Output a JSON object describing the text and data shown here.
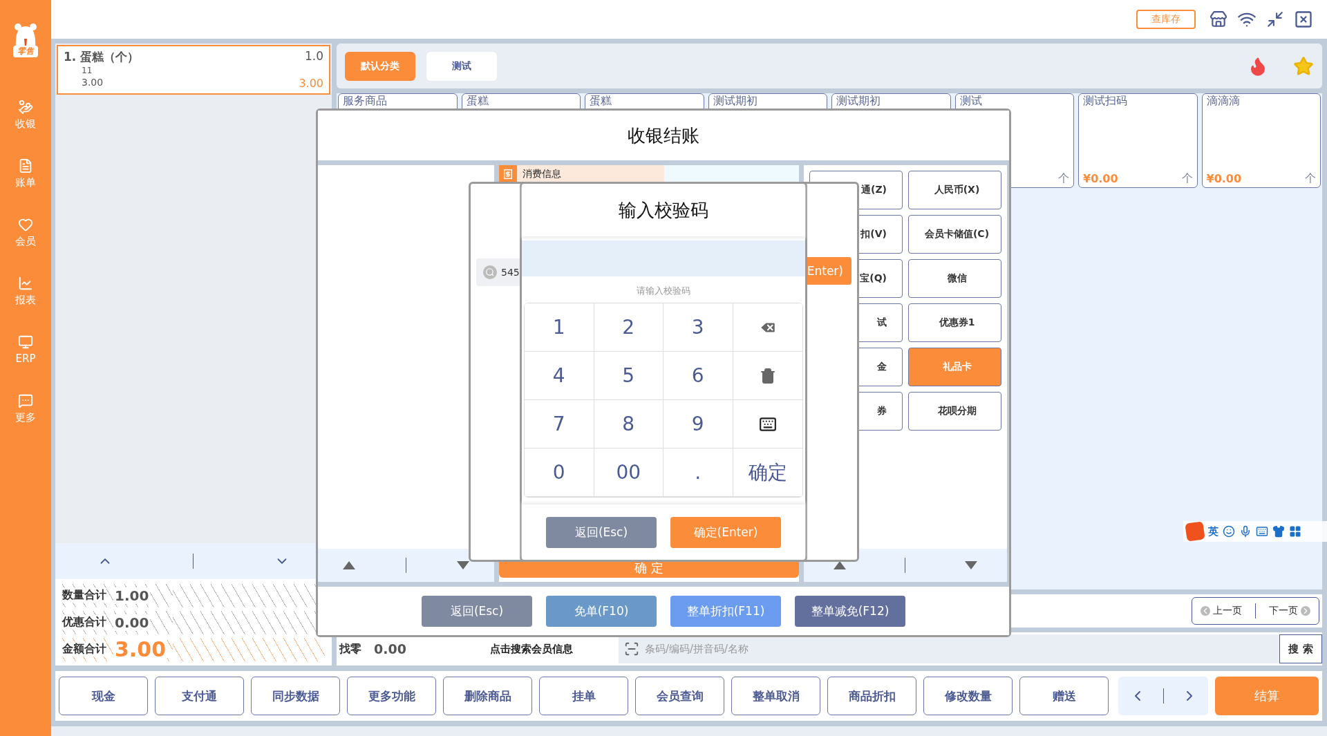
{
  "sidebar": {
    "logo": "零售",
    "items": [
      {
        "label": "收银",
        "kind": "cashier"
      },
      {
        "label": "账单",
        "kind": "bill"
      },
      {
        "label": "会员",
        "kind": "member"
      },
      {
        "label": "报表",
        "kind": "report"
      },
      {
        "label": "ERP",
        "kind": "erp"
      },
      {
        "label": "更多",
        "kind": "more"
      }
    ]
  },
  "topbar": {
    "stock_button": "查库存"
  },
  "cart": {
    "items": [
      {
        "index": "1.",
        "name": "蛋糕（个）",
        "qty": "1.0",
        "code": "11",
        "price": "3.00",
        "amount": "3.00",
        "selected": true
      }
    ]
  },
  "totals": [
    {
      "label": "数量合计",
      "value": "1.00",
      "kind": "plain"
    },
    {
      "label": "优惠合计",
      "value": "0.00",
      "kind": "plain"
    },
    {
      "label": "金额合计",
      "value": "3.00",
      "kind": "emphasis"
    }
  ],
  "categories": [
    {
      "label": "默认分类",
      "selected": true
    },
    {
      "label": "测试",
      "selected": false
    }
  ],
  "products": [
    {
      "name": "服务商品"
    },
    {
      "name": "蛋糕"
    },
    {
      "name": "蛋糕"
    },
    {
      "name": "测试期初"
    },
    {
      "name": "测试期初"
    },
    {
      "name": "测试",
      "unit": "个"
    },
    {
      "name": "测试扫码",
      "price": "¥0.00",
      "unit": "个"
    },
    {
      "name": "滴滴滴",
      "price": "¥0.00",
      "unit": "个"
    }
  ],
  "pager": {
    "prev": "上一页",
    "next": "下一页"
  },
  "change": {
    "label": "找零",
    "value": "0.00"
  },
  "member_link": "点击搜索会员信息",
  "search": {
    "placeholder": "条码/编码/拼音码/名称",
    "button": "搜 索"
  },
  "toolbar": {
    "buttons": [
      "现金",
      "支付通",
      "同步数据",
      "更多功能",
      "删除商品",
      "挂单",
      "会员查询",
      "整单取消",
      "商品折扣",
      "修改数量",
      "赠送"
    ],
    "checkout": "结算"
  },
  "ime_bar": {
    "mode": "英"
  },
  "checkout_dialog": {
    "title": "收银结账",
    "section": "消费信息",
    "confirm": "确 定",
    "payments": [
      {
        "label": "通(Z)",
        "selected": false
      },
      {
        "label": "人民币(X)",
        "selected": false
      },
      {
        "label": "扣(V)",
        "selected": false
      },
      {
        "label": "会员卡储值(C)",
        "selected": false
      },
      {
        "label": "宝(Q)",
        "selected": false
      },
      {
        "label": "微信",
        "selected": false
      },
      {
        "label": "试",
        "selected": false
      },
      {
        "label": "优惠券1",
        "selected": false
      },
      {
        "label": "金",
        "selected": false
      },
      {
        "label": "礼品卡",
        "selected": true
      },
      {
        "label": "券",
        "selected": false
      },
      {
        "label": "花呗分期",
        "selected": false
      }
    ],
    "buttons": [
      {
        "label": "返回(Esc)",
        "kind": "back"
      },
      {
        "label": "免单(F10)",
        "kind": "free"
      },
      {
        "label": "整单折扣(F11)",
        "kind": "discount"
      },
      {
        "label": "整单减免(F12)",
        "kind": "reduce"
      }
    ]
  },
  "gift_card_dialog": {
    "search_value": "545",
    "enter_button": "Enter)"
  },
  "code_dialog": {
    "title": "输入校验码",
    "hint": "请输入校验码",
    "keys": [
      {
        "kind": "text",
        "label": "1"
      },
      {
        "kind": "text",
        "label": "2"
      },
      {
        "kind": "text",
        "label": "3"
      },
      {
        "kind": "backspace"
      },
      {
        "kind": "text",
        "label": "4"
      },
      {
        "kind": "text",
        "label": "5"
      },
      {
        "kind": "text",
        "label": "6"
      },
      {
        "kind": "clear"
      },
      {
        "kind": "text",
        "label": "7"
      },
      {
        "kind": "text",
        "label": "8"
      },
      {
        "kind": "text",
        "label": "9"
      },
      {
        "kind": "keyboard"
      },
      {
        "kind": "text",
        "label": "0"
      },
      {
        "kind": "text",
        "label": "00"
      },
      {
        "kind": "text",
        "label": "."
      },
      {
        "kind": "text",
        "label": "确定"
      }
    ],
    "buttons": [
      {
        "label": "返回(Esc)",
        "kind": "back"
      },
      {
        "label": "确定(Enter)",
        "kind": "primary"
      }
    ]
  }
}
